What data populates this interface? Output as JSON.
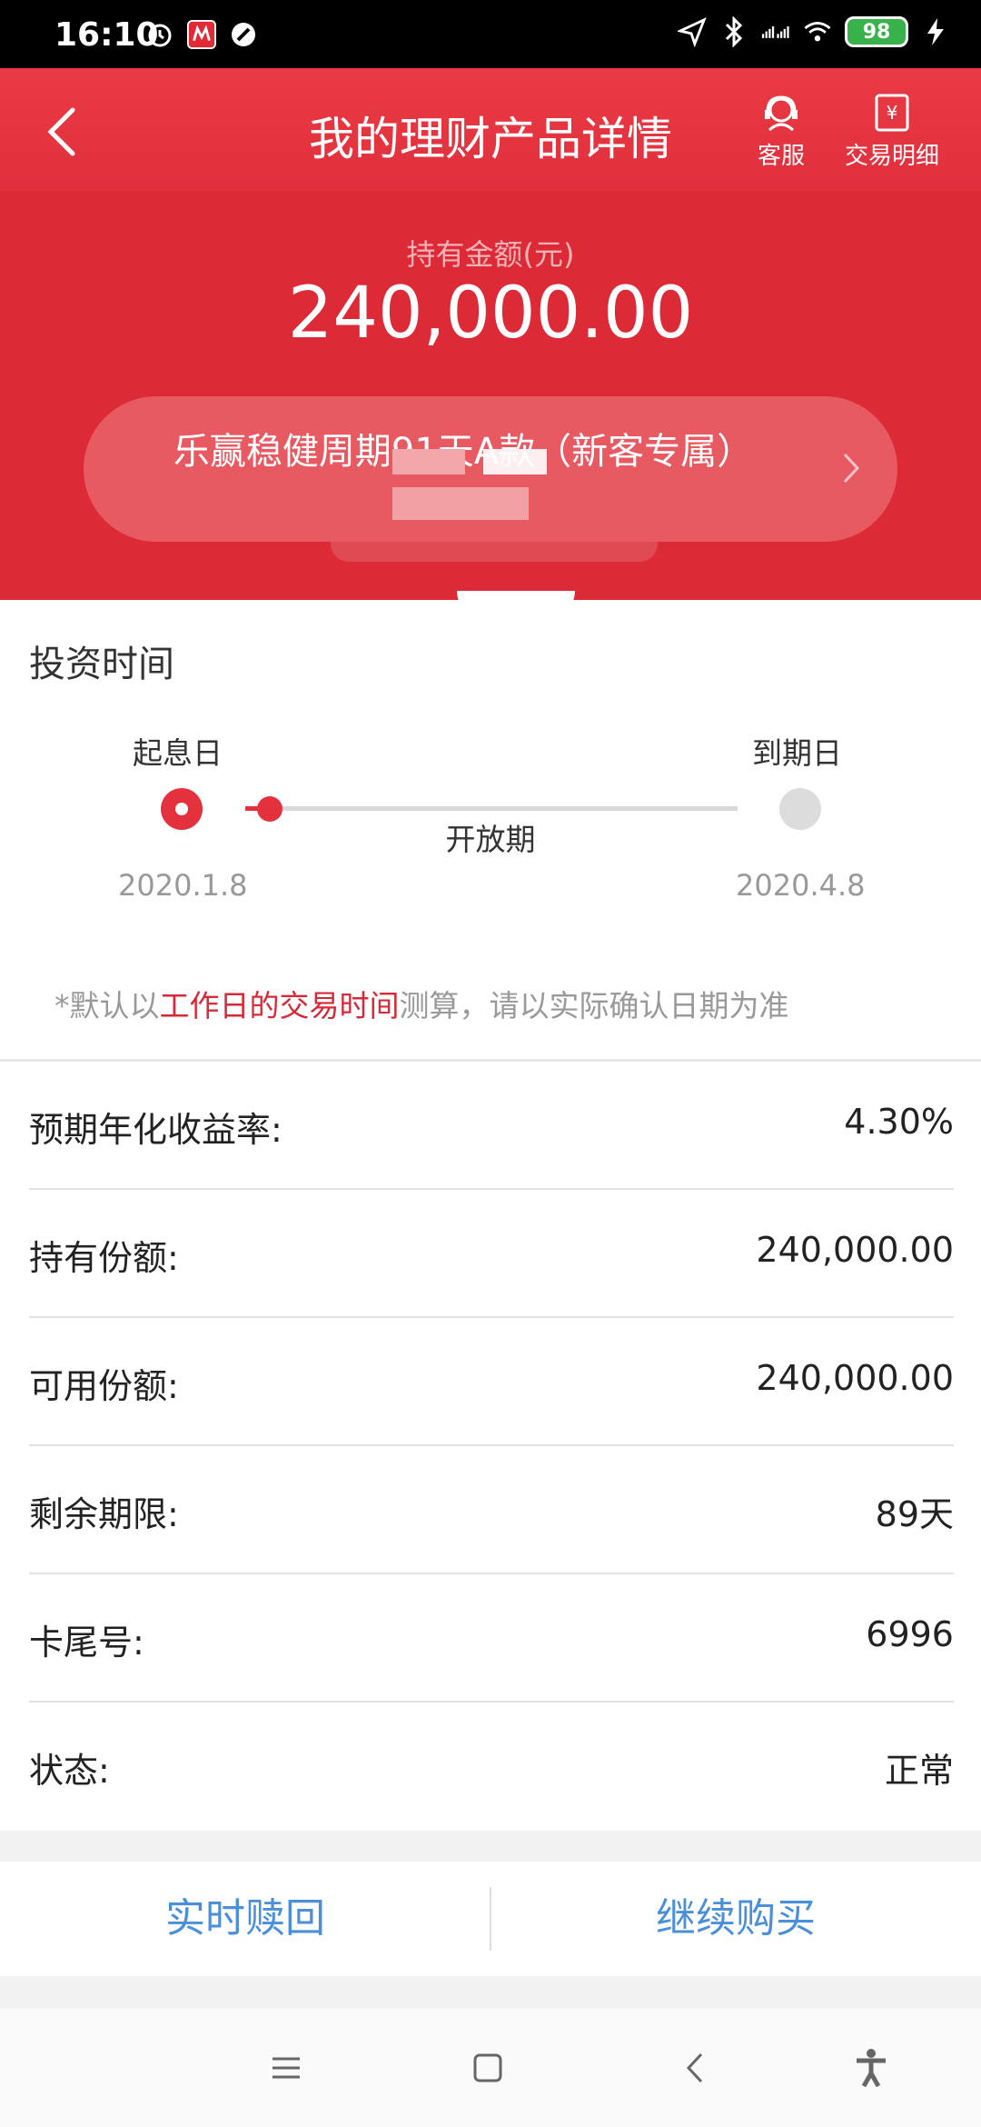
{
  "status_bar": {
    "time": "16:10",
    "battery": "98",
    "icons_left": [
      "alarm-icon",
      "app-badge-icon",
      "dnd-icon"
    ],
    "icons_right": [
      "location-icon",
      "bluetooth-icon",
      "signal-icon",
      "wifi-icon",
      "battery-icon",
      "charging-icon"
    ]
  },
  "header": {
    "title": "我的理财产品详情",
    "service_label": "客服",
    "transactions_label": "交易明细"
  },
  "hero": {
    "amount_label": "持有金额(元)",
    "amount": "240,000.00",
    "product_name": "乐赢稳健周期91天A款（新客专属）"
  },
  "timeline": {
    "section_title": "投资时间",
    "start_label": "起息日",
    "end_label": "到期日",
    "start_date": "2020.1.8",
    "end_date": "2020.4.8",
    "phase_label": "开放期",
    "progress_fraction": 0.05,
    "note_prefix": "*默认以",
    "note_highlight": "工作日的交易时间",
    "note_suffix": "测算，请以实际确认日期为准"
  },
  "details": [
    {
      "label": "预期年化收益率:",
      "value": "4.30%"
    },
    {
      "label": "持有份额:",
      "value": "240,000.00"
    },
    {
      "label": "可用份额:",
      "value": "240,000.00"
    },
    {
      "label": "剩余期限:",
      "value": "89天"
    },
    {
      "label": "卡尾号:",
      "value": "6996"
    },
    {
      "label": "状态:",
      "value": "正常"
    }
  ],
  "actions": {
    "redeem": "实时赎回",
    "buy_more": "继续购买"
  },
  "colors": {
    "brand_red": "#dd2a37",
    "action_blue": "#4a8fd8",
    "highlight_red": "#d52b38"
  }
}
